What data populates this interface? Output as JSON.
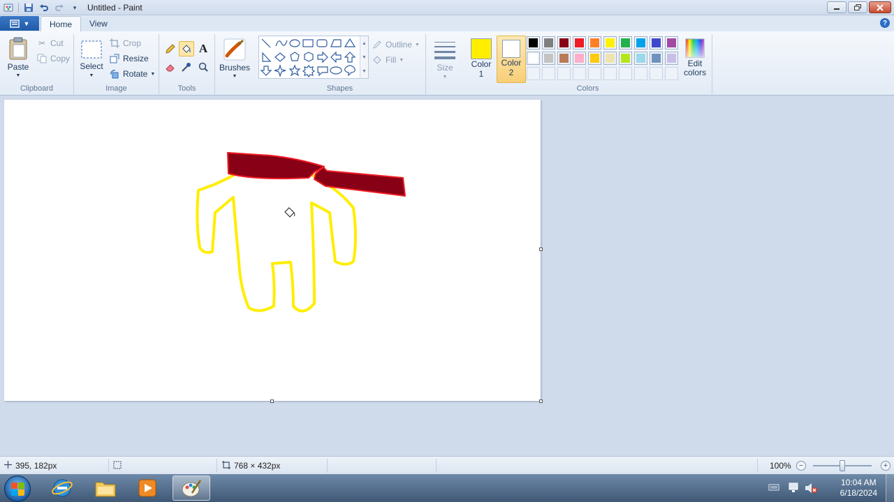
{
  "window": {
    "title": "Untitled - Paint",
    "minimize_icon": "minimize-icon",
    "maximize_icon": "restore-icon",
    "close_icon": "close-icon"
  },
  "quick_access": {
    "items": [
      "paint-app-icon",
      "save-icon",
      "undo-icon",
      "redo-icon",
      "customize-dropdown-icon"
    ]
  },
  "tabs": {
    "menu_label": "",
    "home": "Home",
    "view": "View"
  },
  "ribbon": {
    "clipboard": {
      "label": "Clipboard",
      "paste": "Paste",
      "cut": "Cut",
      "copy": "Copy"
    },
    "image": {
      "label": "Image",
      "select": "Select",
      "crop": "Crop",
      "resize": "Resize",
      "rotate": "Rotate"
    },
    "tools": {
      "label": "Tools",
      "items": [
        "pencil-icon",
        "fill-bucket-icon",
        "text-icon",
        "eraser-icon",
        "color-picker-icon",
        "magnifier-icon"
      ],
      "text_glyph": "A",
      "selected": "fill-bucket-icon"
    },
    "brushes": {
      "label": "Brushes"
    },
    "shapes": {
      "label": "Shapes",
      "outline": "Outline",
      "fill": "Fill"
    },
    "size": {
      "label": "Size"
    },
    "colors": {
      "label": "Colors",
      "color1_line1": "Color",
      "color1_line2": "1",
      "color1_value": "#ffee00",
      "color2_line1": "Color",
      "color2_line2": "2",
      "color2_value": "#ffffff",
      "edit_line1": "Edit",
      "edit_line2": "colors",
      "row1": [
        "#000000",
        "#7f7f7f",
        "#880015",
        "#ed1c24",
        "#ff7f27",
        "#fff200",
        "#22b14c",
        "#00a2e8",
        "#3f48cc",
        "#a349a4"
      ],
      "row2": [
        "#ffffff",
        "#c3c3c3",
        "#b97a57",
        "#ffaec9",
        "#ffc90e",
        "#efe4b0",
        "#b5e61d",
        "#99d9ea",
        "#7092be",
        "#c8bfe7"
      ],
      "row3": [
        "",
        "",
        "",
        "",
        "",
        "",
        "",
        "",
        "",
        ""
      ]
    }
  },
  "status": {
    "cursor_position": "395, 182px",
    "selection_size": "",
    "image_size": "768 × 432px",
    "zoom": "100%"
  },
  "taskbar": {
    "apps": [
      "internet-explorer-icon",
      "file-explorer-icon",
      "media-player-icon",
      "paint-icon"
    ],
    "active_app": "paint-icon",
    "time": "10:04 AM",
    "date": "6/18/2024"
  },
  "drawing": {
    "figure_outline_color": "#ffee00",
    "hat_color": "#880015",
    "hat_outline_color": "#ed1c24"
  }
}
